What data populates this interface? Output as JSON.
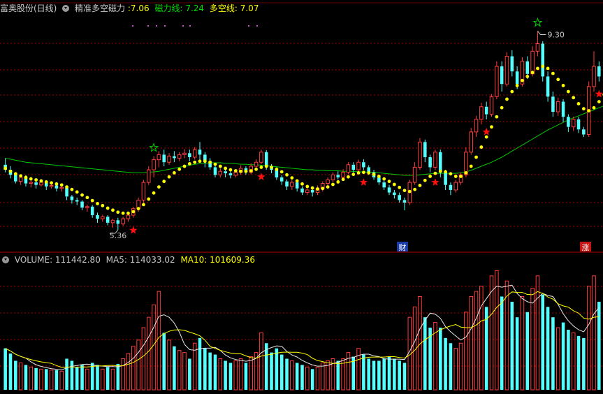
{
  "header": {
    "stock": "富奥股份(日线)",
    "indicator": "精准多空磁力",
    "ind_value": ":7.06",
    "line1_label": "磁力线: 7.24",
    "line2_label": "多空线: 7.07",
    "colors": {
      "stock": "#c8c8c8",
      "indicator": "#c8c8c8",
      "ind_value": "#ffff00",
      "line1": "#00e000",
      "line2": "#ffff00"
    }
  },
  "volume_header": {
    "volume_label": "VOLUME: 111442.80",
    "ma5_label": "MA5: 114033.02",
    "ma10_label": "MA10: 101609.36",
    "colors": {
      "volume": "#c8c8c8",
      "ma5": "#c8c8c8",
      "ma10": "#ffff00"
    }
  },
  "annotations": {
    "high_label": "9.30",
    "low_label": "5.36",
    "finance_badge": "财",
    "limit_up_badge": "涨"
  },
  "colors": {
    "up": "#ff3c3c",
    "down": "#54ffff",
    "grid": "#b00000",
    "ma_green": "#00c800",
    "dots": "#ffff00",
    "star_red": "#ff1010",
    "star_green": "#00d000",
    "purple_marks": "#d84cd8"
  },
  "chart_data": {
    "type": "candlestick",
    "price_range": [
      5.0,
      9.5
    ],
    "high_point": 9.3,
    "low_point": 5.36,
    "candles": [
      [
        6.65,
        6.55,
        6.78,
        6.5,
        40000
      ],
      [
        6.55,
        6.45,
        6.62,
        6.38,
        35000
      ],
      [
        6.45,
        6.32,
        6.5,
        6.28,
        28000
      ],
      [
        6.32,
        6.4,
        6.45,
        6.25,
        26000
      ],
      [
        6.4,
        6.28,
        6.44,
        6.22,
        24000
      ],
      [
        6.28,
        6.3,
        6.36,
        6.2,
        22000
      ],
      [
        6.3,
        6.25,
        6.34,
        6.18,
        21000
      ],
      [
        6.25,
        6.3,
        6.35,
        6.22,
        20000
      ],
      [
        6.3,
        6.22,
        6.32,
        6.15,
        20000
      ],
      [
        6.22,
        6.24,
        6.28,
        6.18,
        19000
      ],
      [
        6.24,
        6.18,
        6.28,
        6.12,
        19000
      ],
      [
        6.18,
        6.2,
        6.26,
        6.12,
        18000
      ],
      [
        6.2,
        6.02,
        6.24,
        5.95,
        30000
      ],
      [
        6.02,
        5.95,
        6.05,
        5.88,
        28000
      ],
      [
        5.95,
        5.92,
        6.0,
        5.85,
        22000
      ],
      [
        5.92,
        5.8,
        5.95,
        5.75,
        24000
      ],
      [
        5.8,
        5.82,
        5.86,
        5.72,
        20000
      ],
      [
        5.82,
        5.65,
        5.85,
        5.6,
        26000
      ],
      [
        5.65,
        5.58,
        5.7,
        5.5,
        24000
      ],
      [
        5.58,
        5.62,
        5.66,
        5.52,
        20000
      ],
      [
        5.62,
        5.5,
        5.65,
        5.45,
        22000
      ],
      [
        5.5,
        5.55,
        5.58,
        5.4,
        20000
      ],
      [
        5.55,
        5.48,
        5.6,
        5.36,
        25000
      ],
      [
        5.48,
        5.58,
        5.62,
        5.44,
        30000
      ],
      [
        5.58,
        5.65,
        5.7,
        5.52,
        35000
      ],
      [
        5.65,
        5.78,
        5.82,
        5.6,
        42000
      ],
      [
        5.78,
        5.95,
        6.0,
        5.72,
        48000
      ],
      [
        5.95,
        6.3,
        6.35,
        5.9,
        60000
      ],
      [
        6.3,
        6.55,
        6.62,
        6.25,
        70000
      ],
      [
        6.55,
        6.75,
        6.82,
        6.4,
        82000
      ],
      [
        6.75,
        6.85,
        6.92,
        6.6,
        95000
      ],
      [
        6.85,
        6.7,
        6.95,
        6.62,
        55000
      ],
      [
        6.7,
        6.82,
        6.88,
        6.65,
        48000
      ],
      [
        6.82,
        6.78,
        6.92,
        6.7,
        42000
      ],
      [
        6.78,
        6.85,
        6.9,
        6.72,
        38000
      ],
      [
        6.85,
        6.88,
        6.96,
        6.78,
        36000
      ],
      [
        6.88,
        6.8,
        6.95,
        6.72,
        30000
      ],
      [
        6.8,
        6.95,
        7.0,
        6.75,
        45000
      ],
      [
        6.95,
        6.85,
        7.1,
        6.7,
        50000
      ],
      [
        6.85,
        6.72,
        6.9,
        6.6,
        40000
      ],
      [
        6.72,
        6.6,
        6.78,
        6.55,
        36000
      ],
      [
        6.6,
        6.45,
        6.65,
        6.4,
        34000
      ],
      [
        6.45,
        6.52,
        6.58,
        6.4,
        30000
      ],
      [
        6.52,
        6.48,
        6.56,
        6.4,
        28000
      ],
      [
        6.48,
        6.44,
        6.52,
        6.38,
        26000
      ],
      [
        6.44,
        6.5,
        6.55,
        6.4,
        28000
      ],
      [
        6.5,
        6.58,
        6.64,
        6.45,
        30000
      ],
      [
        6.58,
        6.5,
        6.62,
        6.45,
        26000
      ],
      [
        6.5,
        6.62,
        6.68,
        6.46,
        32000
      ],
      [
        6.62,
        6.7,
        6.76,
        6.58,
        36000
      ],
      [
        6.7,
        6.9,
        6.95,
        6.66,
        55000
      ],
      [
        6.9,
        6.62,
        6.94,
        6.55,
        45000
      ],
      [
        6.62,
        6.55,
        6.66,
        6.48,
        36000
      ],
      [
        6.55,
        6.4,
        6.6,
        6.35,
        40000
      ],
      [
        6.4,
        6.32,
        6.44,
        6.25,
        34000
      ],
      [
        6.32,
        6.22,
        6.36,
        6.15,
        30000
      ],
      [
        6.22,
        6.3,
        6.35,
        6.15,
        28000
      ],
      [
        6.3,
        6.18,
        6.34,
        6.12,
        26000
      ],
      [
        6.18,
        6.1,
        6.22,
        6.05,
        24000
      ],
      [
        6.1,
        6.15,
        6.2,
        6.05,
        22000
      ],
      [
        6.15,
        6.1,
        6.18,
        6.02,
        20000
      ],
      [
        6.1,
        6.18,
        6.24,
        6.05,
        22000
      ],
      [
        6.18,
        6.28,
        6.32,
        6.12,
        26000
      ],
      [
        6.28,
        6.35,
        6.4,
        6.22,
        28000
      ],
      [
        6.35,
        6.45,
        6.5,
        6.3,
        30000
      ],
      [
        6.45,
        6.4,
        6.52,
        6.36,
        28000
      ],
      [
        6.4,
        6.5,
        6.56,
        6.36,
        30000
      ],
      [
        6.5,
        6.65,
        6.7,
        6.46,
        36000
      ],
      [
        6.65,
        6.55,
        6.7,
        6.5,
        32000
      ],
      [
        6.55,
        6.7,
        6.75,
        6.5,
        40000
      ],
      [
        6.7,
        6.6,
        6.76,
        6.55,
        34000
      ],
      [
        6.6,
        6.5,
        6.64,
        6.45,
        30000
      ],
      [
        6.5,
        6.4,
        6.55,
        6.35,
        28000
      ],
      [
        6.4,
        6.3,
        6.45,
        6.25,
        28000
      ],
      [
        6.3,
        6.2,
        6.35,
        6.15,
        30000
      ],
      [
        6.2,
        6.1,
        6.25,
        6.05,
        32000
      ],
      [
        6.1,
        6.05,
        6.15,
        5.98,
        30000
      ],
      [
        6.05,
        5.95,
        6.1,
        5.9,
        28000
      ],
      [
        5.95,
        5.9,
        6.0,
        5.75,
        26000
      ],
      [
        5.9,
        6.3,
        6.35,
        5.85,
        70000
      ],
      [
        6.3,
        6.6,
        6.7,
        6.25,
        80000
      ],
      [
        6.6,
        7.1,
        7.18,
        6.55,
        90000
      ],
      [
        7.1,
        6.8,
        7.15,
        6.7,
        70000
      ],
      [
        6.8,
        6.6,
        6.85,
        6.5,
        60000
      ],
      [
        6.6,
        6.9,
        6.95,
        6.55,
        65000
      ],
      [
        6.9,
        6.5,
        6.95,
        6.4,
        60000
      ],
      [
        6.5,
        6.25,
        6.55,
        6.15,
        50000
      ],
      [
        6.25,
        6.15,
        6.3,
        6.05,
        45000
      ],
      [
        6.15,
        6.3,
        6.35,
        6.1,
        40000
      ],
      [
        6.3,
        6.45,
        6.5,
        6.25,
        45000
      ],
      [
        6.45,
        6.9,
        7.0,
        6.4,
        75000
      ],
      [
        6.9,
        7.3,
        7.38,
        6.85,
        90000
      ],
      [
        7.3,
        7.55,
        7.62,
        7.2,
        95000
      ],
      [
        7.55,
        7.8,
        7.88,
        7.45,
        100000
      ],
      [
        7.8,
        7.65,
        7.9,
        7.55,
        80000
      ],
      [
        7.65,
        8.0,
        8.05,
        7.6,
        110000
      ],
      [
        8.0,
        8.6,
        8.7,
        7.95,
        115000
      ],
      [
        8.6,
        8.25,
        8.7,
        8.1,
        90000
      ],
      [
        8.25,
        8.8,
        8.88,
        8.2,
        105000
      ],
      [
        8.8,
        8.5,
        8.92,
        8.4,
        85000
      ],
      [
        8.5,
        8.25,
        8.6,
        8.15,
        70000
      ],
      [
        8.25,
        8.7,
        8.78,
        8.2,
        90000
      ],
      [
        8.7,
        8.45,
        8.8,
        8.35,
        75000
      ],
      [
        8.45,
        8.9,
        9.0,
        8.4,
        98000
      ],
      [
        8.9,
        9.05,
        9.3,
        8.8,
        110000
      ],
      [
        9.05,
        8.4,
        9.1,
        8.3,
        92000
      ],
      [
        8.4,
        8.0,
        8.5,
        7.9,
        80000
      ],
      [
        8.0,
        7.7,
        8.1,
        7.6,
        70000
      ],
      [
        7.7,
        7.9,
        7.98,
        7.62,
        60000
      ],
      [
        7.9,
        7.6,
        7.95,
        7.5,
        65000
      ],
      [
        7.6,
        7.4,
        7.65,
        7.3,
        58000
      ],
      [
        7.4,
        7.55,
        7.6,
        7.32,
        55000
      ],
      [
        7.55,
        7.35,
        7.6,
        7.28,
        52000
      ],
      [
        7.35,
        7.25,
        7.4,
        7.2,
        50000
      ],
      [
        7.25,
        8.2,
        8.3,
        7.2,
        100000
      ],
      [
        8.2,
        8.6,
        8.9,
        8.1,
        110000
      ],
      [
        8.6,
        8.4,
        8.7,
        8.3,
        85000
      ]
    ],
    "ma_line": [
      6.78,
      6.76,
      6.74,
      6.72,
      6.7,
      6.69,
      6.68,
      6.67,
      6.66,
      6.65,
      6.64,
      6.63,
      6.62,
      6.61,
      6.6,
      6.59,
      6.58,
      6.57,
      6.56,
      6.55,
      6.54,
      6.53,
      6.52,
      6.51,
      6.5,
      6.49,
      6.49,
      6.49,
      6.5,
      6.51,
      6.52,
      6.54,
      6.56,
      6.58,
      6.6,
      6.62,
      6.64,
      6.66,
      6.67,
      6.68,
      6.69,
      6.69,
      6.69,
      6.68,
      6.68,
      6.67,
      6.66,
      6.66,
      6.65,
      6.65,
      6.64,
      6.63,
      6.62,
      6.61,
      6.6,
      6.59,
      6.58,
      6.57,
      6.56,
      6.55,
      6.55,
      6.54,
      6.54,
      6.53,
      6.53,
      6.53,
      6.52,
      6.52,
      6.52,
      6.51,
      6.51,
      6.5,
      6.5,
      6.49,
      6.48,
      6.47,
      6.46,
      6.45,
      6.44,
      6.44,
      6.44,
      6.45,
      6.46,
      6.47,
      6.48,
      6.48,
      6.48,
      6.48,
      6.48,
      6.49,
      6.51,
      6.54,
      6.58,
      6.62,
      6.66,
      6.7,
      6.75,
      6.8,
      6.86,
      6.92,
      6.98,
      7.04,
      7.1,
      7.16,
      7.22,
      7.28,
      7.34,
      7.39,
      7.44,
      7.49,
      7.54,
      7.58,
      7.62,
      7.66,
      7.7,
      7.74,
      7.78,
      7.82
    ],
    "dot_line": [
      6.58,
      6.52,
      6.47,
      6.43,
      6.4,
      6.37,
      6.35,
      6.33,
      6.31,
      6.29,
      6.27,
      6.25,
      6.21,
      6.16,
      6.11,
      6.05,
      6.0,
      5.94,
      5.88,
      5.84,
      5.79,
      5.75,
      5.71,
      5.69,
      5.69,
      5.72,
      5.78,
      5.86,
      5.97,
      6.09,
      6.21,
      6.32,
      6.41,
      6.49,
      6.56,
      6.62,
      6.67,
      6.7,
      6.72,
      6.72,
      6.7,
      6.66,
      6.62,
      6.58,
      6.55,
      6.53,
      6.52,
      6.52,
      6.53,
      6.56,
      6.6,
      6.62,
      6.6,
      6.56,
      6.51,
      6.45,
      6.39,
      6.33,
      6.27,
      6.22,
      6.19,
      6.17,
      6.18,
      6.21,
      6.26,
      6.31,
      6.36,
      6.41,
      6.46,
      6.49,
      6.5,
      6.49,
      6.46,
      6.42,
      6.37,
      6.32,
      6.26,
      6.2,
      6.14,
      6.12,
      6.16,
      6.24,
      6.34,
      6.42,
      6.48,
      6.52,
      6.51,
      6.47,
      6.42,
      6.42,
      6.49,
      6.62,
      6.8,
      7.0,
      7.2,
      7.4,
      7.6,
      7.78,
      7.95,
      8.1,
      8.22,
      8.32,
      8.4,
      8.48,
      8.56,
      8.6,
      8.56,
      8.46,
      8.34,
      8.22,
      8.1,
      7.98,
      7.86,
      7.76,
      7.72,
      7.78,
      7.9,
      8.04
    ],
    "red_stars": [
      25,
      50,
      70,
      84,
      94,
      116
    ],
    "green_stars": [
      29,
      104
    ],
    "volume_range": [
      0,
      120000
    ]
  }
}
